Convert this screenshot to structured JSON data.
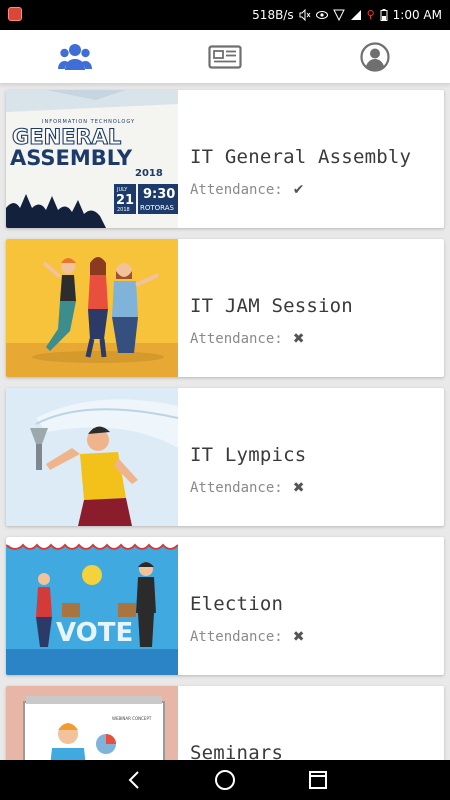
{
  "status_bar": {
    "net_speed": "518B/s",
    "time": "1:00 AM"
  },
  "tabs": [
    {
      "icon": "users-icon",
      "active": true
    },
    {
      "icon": "newspaper-icon",
      "active": false
    },
    {
      "icon": "account-icon",
      "active": false
    }
  ],
  "thumbnails": {
    "ga_line1": "INFORMATION TECHNOLOGY",
    "ga_line2": "GENERAL",
    "ga_line3": "ASSEMBLY",
    "ga_year": "2018",
    "ga_month": "JULY",
    "ga_day": "21",
    "ga_year2": "2018",
    "ga_time": "9:30",
    "ga_venue": "ROTORAS",
    "vote_text": "VOTE",
    "seminar_board": "WEBINAR CONCEPT"
  },
  "events": [
    {
      "title": "IT General Assembly",
      "attendance_label": "Attendance:",
      "attendance_icon": "✔",
      "attended": true
    },
    {
      "title": "IT JAM Session",
      "attendance_label": "Attendance:",
      "attendance_icon": "✖",
      "attended": false
    },
    {
      "title": "IT Lympics",
      "attendance_label": "Attendance:",
      "attendance_icon": "✖",
      "attended": false
    },
    {
      "title": "Election",
      "attendance_label": "Attendance:",
      "attendance_icon": "✖",
      "attended": false
    },
    {
      "title": "Seminars",
      "attendance_label": "",
      "attendance_icon": "",
      "attended": false
    }
  ],
  "colors": {
    "accent": "#3f6fd6",
    "tab_inactive": "#6f6f6f"
  }
}
